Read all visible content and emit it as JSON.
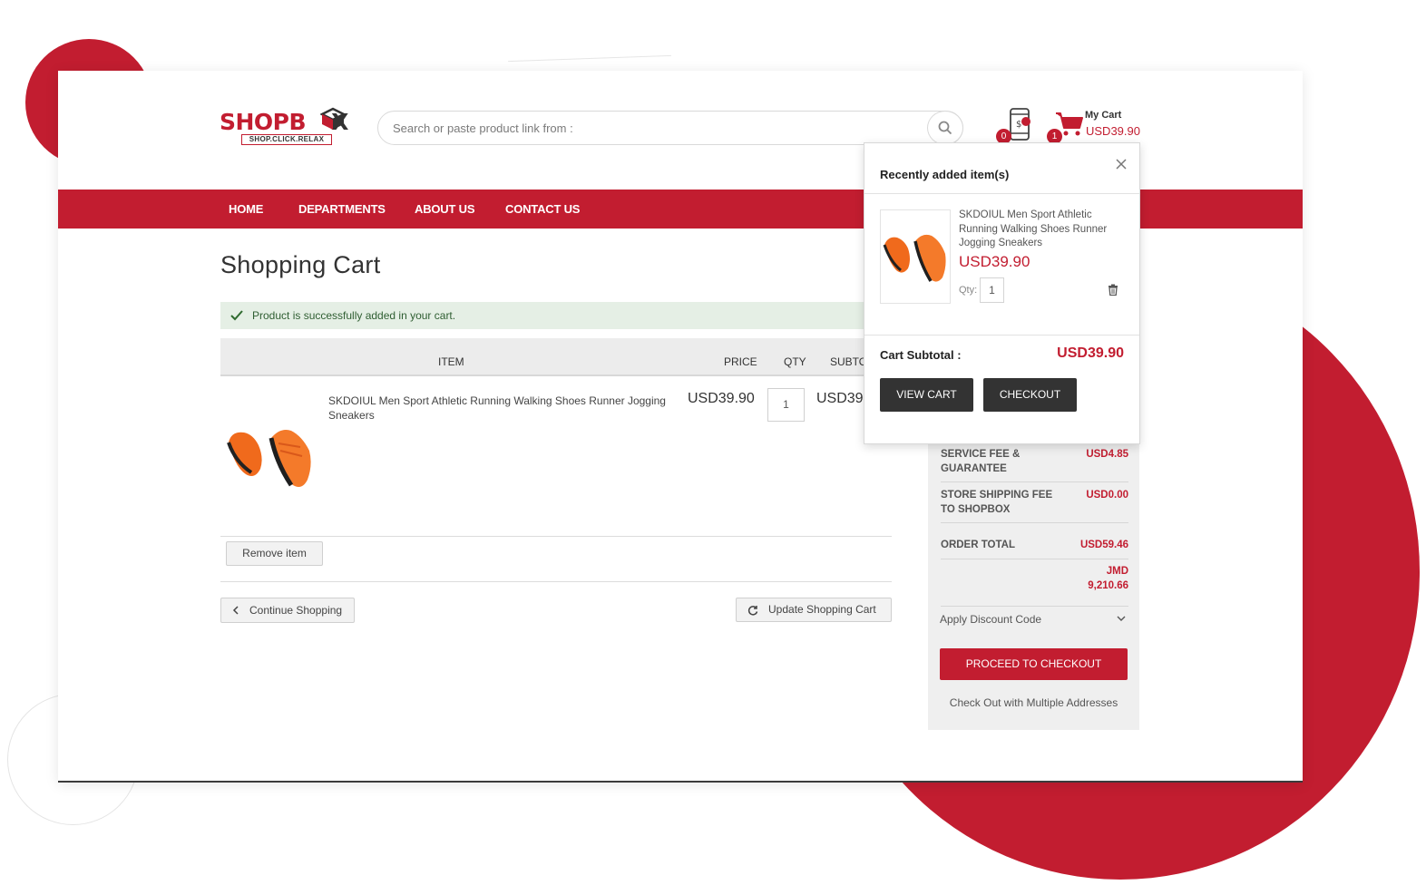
{
  "header": {
    "logo_main": "SHOPB",
    "logo_end": "X",
    "logo_tagline": "SHOP.CLICK.RELAX",
    "search_placeholder": "Search or paste product link from :",
    "phone_badge": "0",
    "cart_badge": "1",
    "my_cart_label": "My Cart",
    "my_cart_total": "USD39.90"
  },
  "nav": {
    "items": [
      "HOME",
      "DEPARTMENTS",
      "ABOUT US",
      "CONTACT US"
    ]
  },
  "main": {
    "title": "Shopping Cart",
    "success_message": "Product is successfully added in your cart.",
    "table_headers": {
      "item": "ITEM",
      "price": "PRICE",
      "qty": "QTY",
      "subtotal": "SUBTOTAL"
    },
    "product": {
      "name": "SKDOIUL Men Sport Athletic Running Walking Shoes Runner Jogging Sneakers",
      "price": "USD39.90",
      "qty": "1",
      "subtotal": "USD39.90"
    },
    "remove_label": "Remove item",
    "continue_label": "Continue Shopping",
    "update_label": "Update Shopping Cart"
  },
  "summary": {
    "service_fee_label": "SERVICE FEE & GUARANTEE",
    "service_fee_value": "USD4.85",
    "shipping_label": "STORE SHIPPING FEE TO SHOPBOX",
    "shipping_value": "USD0.00",
    "order_total_label": "ORDER TOTAL",
    "order_total_value": "USD59.46",
    "order_total_local_currency": "JMD",
    "order_total_local_value": "9,210.66",
    "discount_label": "Apply Discount Code",
    "proceed_label": "PROCEED TO CHECKOUT",
    "multi_address_label": "Check Out with Multiple Addresses"
  },
  "minicart": {
    "title": "Recently added item(s)",
    "item_name": "SKDOIUL Men Sport Athletic Running Walking Shoes Runner Jogging Sneakers",
    "item_price": "USD39.90",
    "qty_label": "Qty:",
    "qty_value": "1",
    "subtotal_label": "Cart Subtotal :",
    "subtotal_value": "USD39.90",
    "view_cart_label": "VIEW CART",
    "checkout_label": "CHECKOUT"
  },
  "colors": {
    "brand_red": "#c21d30",
    "dark_button": "#333333",
    "success_bg": "#e5efe5"
  },
  "icons": [
    "search-icon",
    "phone-dollar-icon",
    "cart-icon",
    "close-icon",
    "trash-icon",
    "check-icon",
    "chevron-left-icon",
    "refresh-icon",
    "chevron-down-icon"
  ]
}
